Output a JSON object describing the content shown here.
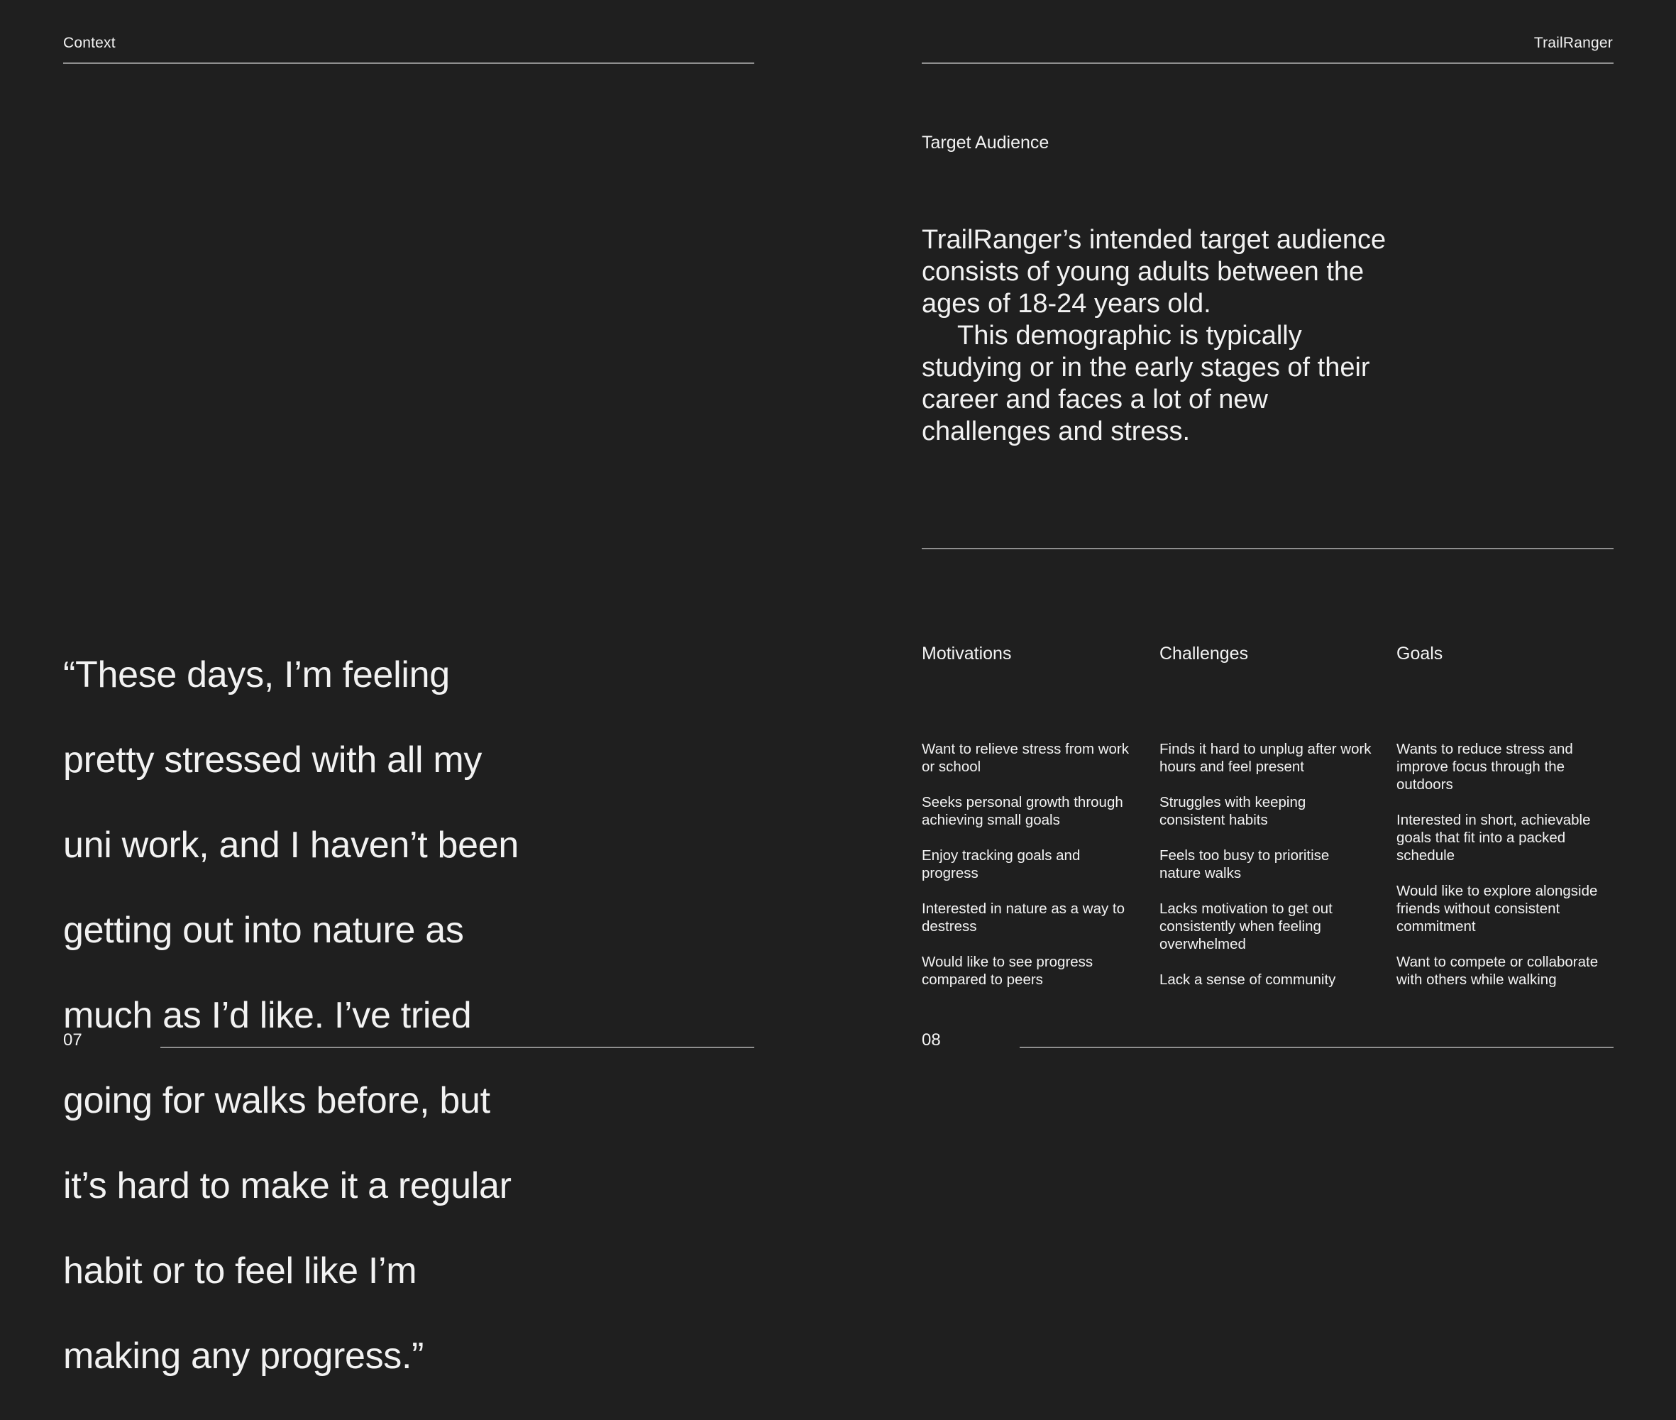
{
  "left_page": {
    "header": "Context",
    "quote_lines": [
      "“These days, I’m feeling",
      "pretty stressed with all my",
      "uni work, and I haven’t been",
      "getting out into nature as",
      "much as I’d like. I’ve tried",
      "going for walks before, but",
      "it’s hard to make it a regular",
      "habit or to feel like I’m",
      "making any progress.”"
    ],
    "page_number": "07"
  },
  "right_page": {
    "header": "TrailRanger",
    "section_title": "Target Audience",
    "audience_paragraph_1": "TrailRanger’s intended target audience consists of young adults between the ages of 18-24 years old.",
    "audience_paragraph_2": "This demographic is typically studying or in the early stages of their career and faces a lot of new challenges and stress.",
    "columns": [
      {
        "title": "Motivations",
        "items": [
          "Want to relieve stress from work or school",
          "Seeks personal growth through achieving small goals",
          "Enjoy tracking goals and progress",
          "Interested in nature as a way to destress",
          "Would like to see progress compared to peers"
        ]
      },
      {
        "title": "Challenges",
        "items": [
          "Finds it hard to unplug after work hours and feel present",
          "Struggles with keeping consistent habits",
          "Feels too busy to prioritise nature walks",
          "Lacks motivation to get out consistently when feeling overwhelmed",
          "Lack a sense of community"
        ]
      },
      {
        "title": "Goals",
        "items": [
          "Wants to reduce stress and improve focus through the outdoors",
          "Interested in short, achievable goals that fit into a packed schedule",
          "Would like to explore alongside friends without consistent commitment",
          "Want to compete or collaborate with others while walking"
        ]
      }
    ],
    "page_number": "08"
  }
}
